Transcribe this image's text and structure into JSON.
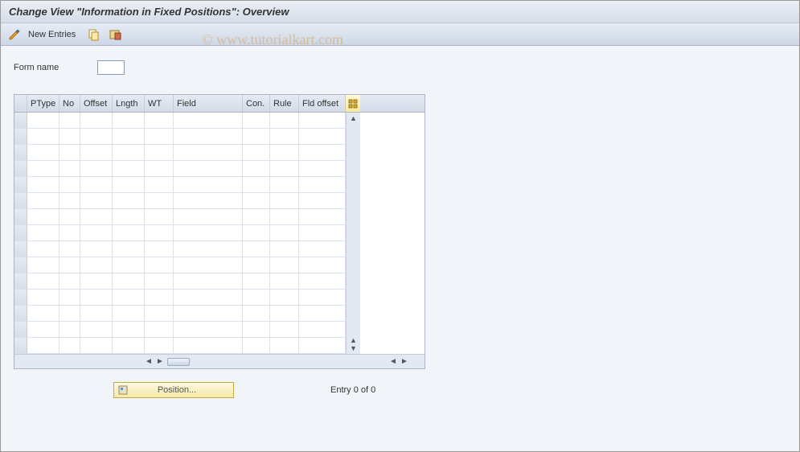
{
  "title": "Change View \"Information in Fixed Positions\": Overview",
  "toolbar": {
    "new_entries_label": "New Entries"
  },
  "form": {
    "name_label": "Form name",
    "name_value": ""
  },
  "grid": {
    "headers": {
      "ptype": "PType",
      "no": "No",
      "offset": "Offset",
      "lngth": "Lngth",
      "wt": "WT",
      "field": "Field",
      "con": "Con.",
      "rule": "Rule",
      "fldoff": "Fld offset"
    },
    "row_count": 15
  },
  "footer": {
    "position_label": "Position...",
    "entry_text": "Entry 0 of 0"
  },
  "watermark": "© www.tutorialkart.com"
}
